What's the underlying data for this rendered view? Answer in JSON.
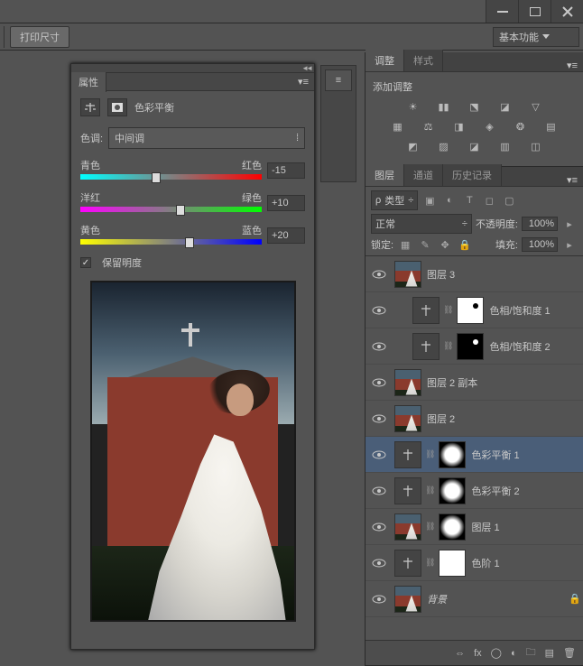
{
  "window": {
    "print_size": "打印尺寸",
    "workspace": "基本功能"
  },
  "properties": {
    "tab": "属性",
    "title": "色彩平衡",
    "tone_label": "色调:",
    "tone_value": "中间调",
    "sliders": [
      {
        "left": "青色",
        "right": "红色",
        "value": -15,
        "pos": 42
      },
      {
        "left": "洋红",
        "right": "绿色",
        "value": "+10",
        "pos": 55
      },
      {
        "left": "黄色",
        "right": "蓝色",
        "value": "+20",
        "pos": 60
      }
    ],
    "preserve_lum": "保留明度"
  },
  "adjustments": {
    "tab1": "调整",
    "tab2": "样式",
    "add_label": "添加调整"
  },
  "layers_panel": {
    "tabs": [
      "图层",
      "通道",
      "历史记录"
    ],
    "kind_label": "类型",
    "blend": "正常",
    "opacity_label": "不透明度:",
    "opacity_value": "100%",
    "lock_label": "锁定:",
    "fill_label": "填充:",
    "fill_value": "100%"
  },
  "layers": [
    {
      "name": "图层 3",
      "type": "photo"
    },
    {
      "name": "色相/饱和度 1",
      "type": "adj",
      "mask": "dotw",
      "indent": true
    },
    {
      "name": "色相/饱和度 2",
      "type": "adj",
      "mask": "dotb",
      "indent": true
    },
    {
      "name": "图层 2 副本",
      "type": "photo"
    },
    {
      "name": "图层 2",
      "type": "photo"
    },
    {
      "name": "色彩平衡 1",
      "type": "adj",
      "mask": "gray",
      "sel": true
    },
    {
      "name": "色彩平衡 2",
      "type": "adj",
      "mask": "gray"
    },
    {
      "name": "图层 1",
      "type": "photo",
      "mask": "gray"
    },
    {
      "name": "色阶 1",
      "type": "adj",
      "mask": "mask"
    },
    {
      "name": "背景",
      "type": "photo",
      "locked": true,
      "italic": true
    }
  ]
}
